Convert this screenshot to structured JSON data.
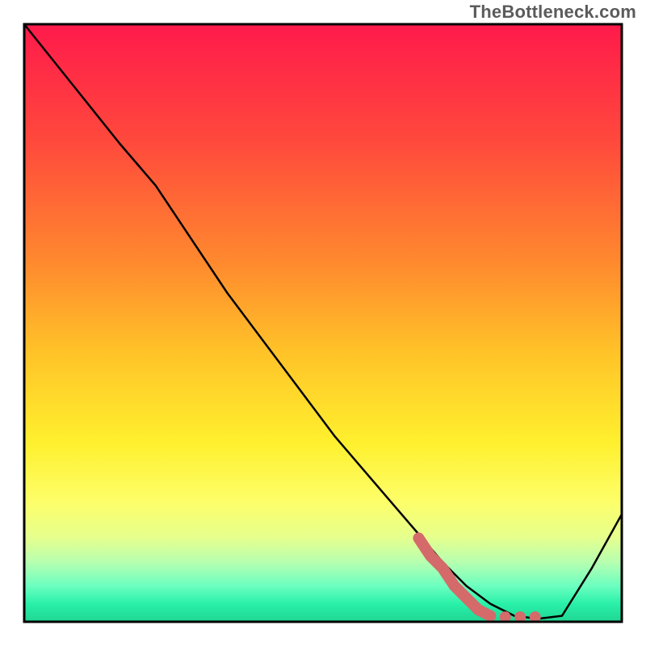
{
  "watermark": "TheBottleneck.com",
  "chart_data": {
    "type": "line",
    "title": "",
    "xlabel": "",
    "ylabel": "",
    "xlim": [
      0,
      100
    ],
    "ylim": [
      0,
      100
    ],
    "background": {
      "type": "vertical-gradient",
      "stops": [
        {
          "offset": 0.0,
          "color": "#ff1a4b"
        },
        {
          "offset": 0.2,
          "color": "#ff4a3c"
        },
        {
          "offset": 0.4,
          "color": "#ff8a2e"
        },
        {
          "offset": 0.55,
          "color": "#ffc328"
        },
        {
          "offset": 0.7,
          "color": "#fff02e"
        },
        {
          "offset": 0.8,
          "color": "#fdff6a"
        },
        {
          "offset": 0.86,
          "color": "#e5ff8e"
        },
        {
          "offset": 0.9,
          "color": "#b7ffb0"
        },
        {
          "offset": 0.94,
          "color": "#6cffc0"
        },
        {
          "offset": 0.97,
          "color": "#29f0a9"
        },
        {
          "offset": 1.0,
          "color": "#1fd692"
        }
      ]
    },
    "series": [
      {
        "name": "curve",
        "type": "line",
        "color": "#000000",
        "x": [
          0,
          8,
          16,
          22,
          28,
          34,
          40,
          46,
          52,
          58,
          64,
          70,
          74,
          78,
          82,
          86,
          90,
          95,
          100
        ],
        "y": [
          100,
          90,
          80,
          73,
          64,
          55,
          47,
          39,
          31,
          24,
          17,
          10,
          6,
          3,
          1,
          0.5,
          1,
          9,
          18
        ]
      },
      {
        "name": "highlight-stroke",
        "type": "line",
        "color": "#d46a6a",
        "thick": true,
        "x": [
          66,
          68,
          70,
          72,
          74,
          76,
          78
        ],
        "y": [
          14,
          11,
          9,
          6,
          4,
          2,
          1
        ]
      },
      {
        "name": "highlight-dots",
        "type": "scatter",
        "color": "#d46a6a",
        "x": [
          78,
          80.5,
          83,
          85.5
        ],
        "y": [
          1,
          0.8,
          0.8,
          0.8
        ]
      }
    ],
    "frame": {
      "color": "#000000",
      "width": 3
    }
  }
}
